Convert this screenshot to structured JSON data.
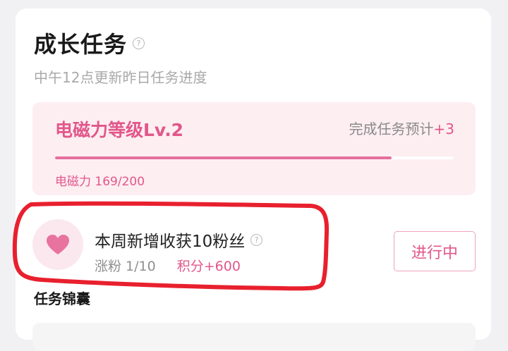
{
  "header": {
    "title": "成长任务",
    "help_icon": "question-circle-icon",
    "subtitle": "中午12点更新昨日任务进度"
  },
  "level": {
    "title": "电磁力等级Lv.2",
    "estimate_label": "完成任务预计",
    "estimate_value": "+3",
    "progress_label": "电磁力 169/200",
    "progress_current": 169,
    "progress_max": 200
  },
  "task": {
    "icon": "heart-icon",
    "title": "本周新增收获10粉丝",
    "help_icon": "question-circle-icon",
    "fans_progress": "涨粉 1/10",
    "points": "积分+600",
    "status": "进行中"
  },
  "section": {
    "title": "任务锦囊"
  },
  "colors": {
    "accent": "#e2578a",
    "level_bg": "#fdeef2",
    "annotation": "#e8202e"
  }
}
